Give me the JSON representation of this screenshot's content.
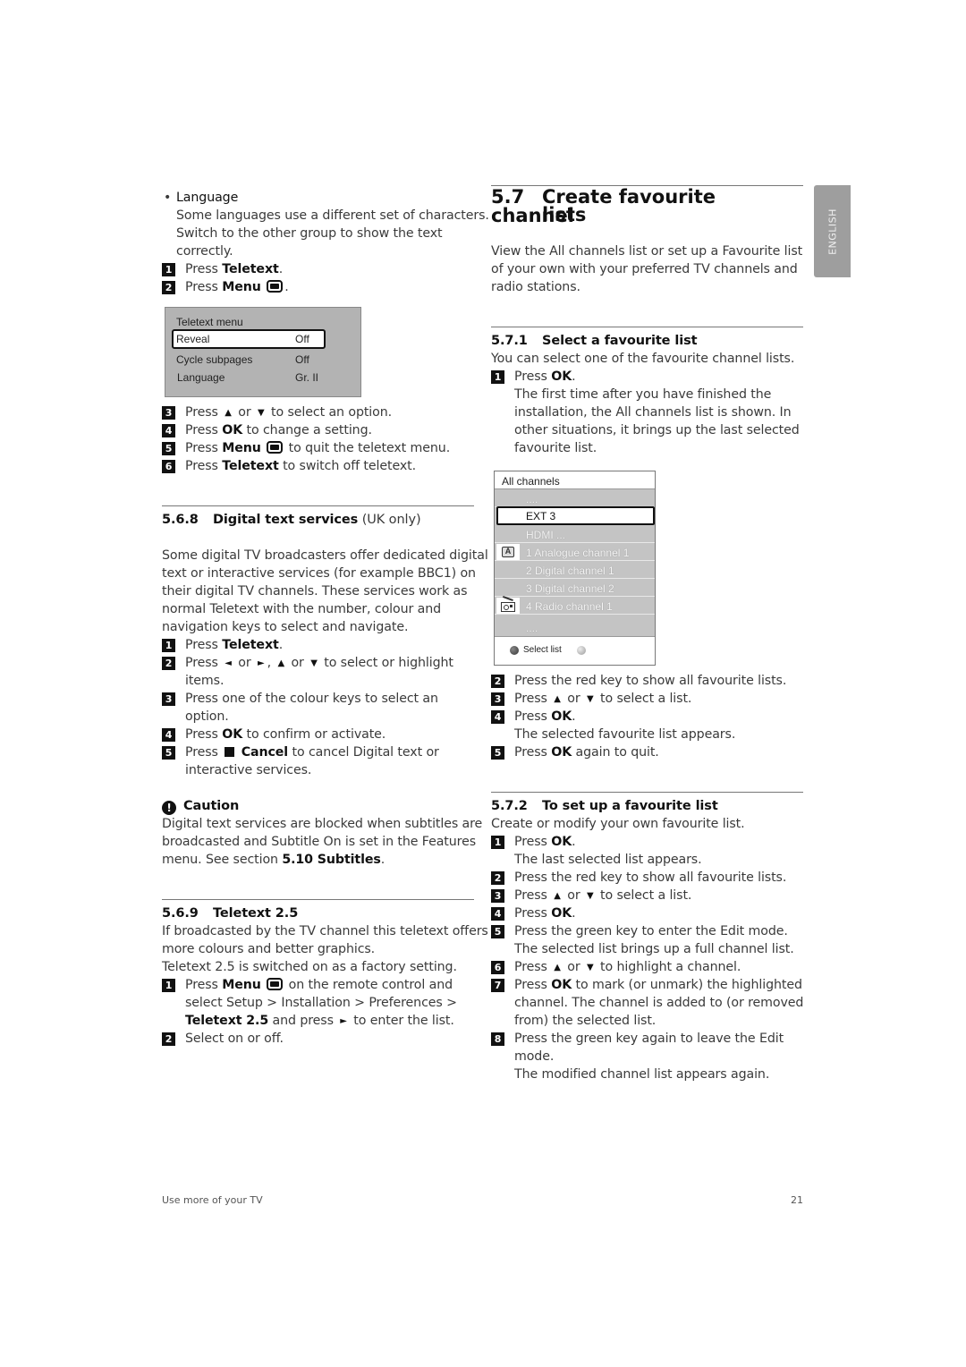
{
  "left": {
    "language_bullet": "Language",
    "language_desc": [
      "Some languages use a different set of characters.",
      "Switch to the other group to show the text",
      "correctly."
    ],
    "steps_a": [
      {
        "n": "1",
        "pre": "Press ",
        "key": "Teletext",
        "post": "."
      },
      {
        "n": "2",
        "pre": "Press ",
        "key": "Menu",
        "post": "."
      }
    ],
    "teletext_menu": {
      "title": "Teletext menu",
      "rows": [
        {
          "label": "Reveal",
          "value": "Off",
          "selected": true
        },
        {
          "label": "Cycle subpages",
          "value": "Off"
        },
        {
          "label": "Language",
          "value": "Gr. II"
        }
      ]
    },
    "steps_b": [
      {
        "n": "3",
        "pre": "Press",
        "mid": "or",
        "post": "to select an option."
      },
      {
        "n": "4",
        "pre": "Press ",
        "key": "OK",
        "post": " to change a setting."
      },
      {
        "n": "5",
        "pre": "Press ",
        "key": "Menu",
        "post": " to quit the teletext menu."
      },
      {
        "n": "6",
        "pre": "Press ",
        "key": "Teletext",
        "post": " to switch off teletext."
      }
    ],
    "s568": {
      "num": "5.6.8",
      "title": "Digital text services",
      "suffix": " (UK only)",
      "para": [
        "Some digital TV broadcasters offer dedicated digital",
        "text or interactive services (for example BBC1) on",
        "their digital TV channels. These services work as",
        "normal Teletext with the number, colour and",
        "navigation keys to select and navigate."
      ],
      "step1": {
        "n": "1",
        "pre": "Press ",
        "key": "Teletext",
        "post": "."
      },
      "step2": {
        "n": "2",
        "pre": "Press",
        "or1": "or",
        "or2": "or",
        "post": "to select or highlight",
        "cont": "items."
      },
      "step3": {
        "n": "3",
        "text": "Press one of the colour keys to select an",
        "cont": "option."
      },
      "step4": {
        "n": "4",
        "pre": "Press ",
        "key": "OK",
        "post": " to confirm or activate."
      },
      "step5": {
        "n": "5",
        "pre": "Press",
        "key": "Cancel",
        "post": " to cancel Digital text or",
        "cont": "interactive services."
      }
    },
    "caution": {
      "title": "Caution",
      "lines": [
        "Digital text services are blocked when subtitles are",
        "broadcasted and Subtitle On is set in the Features"
      ],
      "last_pre": "menu. See section ",
      "last_key": "5.10 Subtitles",
      "last_post": "."
    },
    "s569": {
      "num": "5.6.9",
      "title": "Teletext 2.5",
      "para": [
        "If broadcasted by the TV channel this teletext offers",
        "more colours and better graphics.",
        "Teletext 2.5 is switched on as a factory setting."
      ],
      "step1": {
        "n": "1",
        "pre": "Press ",
        "key": "Menu",
        "post": " on the remote control and",
        "cont1": "select Setup > Installation > Preferences >",
        "cont2_key": "Teletext 2.5",
        "cont2_post": " and press",
        "cont2_end": "to enter the list."
      },
      "step2": {
        "n": "2",
        "text": "Select on or off."
      }
    }
  },
  "right": {
    "s57": {
      "num": "5.7",
      "title_l1": "Create favourite channel",
      "title_l2": "lists"
    },
    "intro": [
      "View the All channels list or set up a Favourite list",
      "of your own with your preferred TV channels and",
      "radio stations."
    ],
    "s571": {
      "num": "5.7.1",
      "title": "Select a favourite list",
      "desc": "You can select one of the favourite channel lists.",
      "step1": {
        "n": "1",
        "pre": "Press ",
        "key": "OK",
        "post": "."
      },
      "step1_desc": [
        "The first time after you have finished the",
        "installation, the All channels list is shown. In",
        "other situations, it brings up the last selected",
        "favourite list."
      ]
    },
    "channel_list": {
      "title": "All channels",
      "rows": [
        {
          "text": "....",
          "icon": ""
        },
        {
          "text": "EXT 3",
          "icon": "",
          "selected": true
        },
        {
          "text": "HDMI ...",
          "icon": ""
        },
        {
          "text": "1 Analogue channel 1",
          "icon": "analogue-icon"
        },
        {
          "text": "2 Digital channel 1",
          "icon": ""
        },
        {
          "text": "3 Digital channel 2",
          "icon": ""
        },
        {
          "text": "4 Radio channel 1",
          "icon": "radio-icon"
        },
        {
          "text": "....",
          "icon": ""
        }
      ],
      "footer_label": "Select list",
      "analogue_glyph": "A"
    },
    "s571_steps": [
      {
        "n": "2",
        "text": "Press the red key to show all favourite lists."
      },
      {
        "n": "3",
        "pre": "Press",
        "mid": "or",
        "post": "to select a list."
      },
      {
        "n": "4",
        "pre": "Press ",
        "key": "OK",
        "post": ".",
        "cont": "The selected favourite list appears."
      },
      {
        "n": "5",
        "pre": "Press ",
        "key": "OK",
        "post": " again to quit."
      }
    ],
    "s572": {
      "num": "5.7.2",
      "title": "To set up a favourite list",
      "desc": "Create or modify your own favourite list.",
      "steps": [
        {
          "n": "1",
          "pre": "Press ",
          "key": "OK",
          "post": ".",
          "cont": "The last selected list appears."
        },
        {
          "n": "2",
          "text": "Press the red key to show all favourite lists."
        },
        {
          "n": "3",
          "pre": "Press",
          "mid": "or",
          "post": "to select a list."
        },
        {
          "n": "4",
          "pre": "Press ",
          "key": "OK",
          "post": "."
        },
        {
          "n": "5",
          "text": "Press the green key to enter the Edit mode.",
          "cont": "The selected list brings up a full channel list."
        },
        {
          "n": "6",
          "pre": "Press",
          "mid": "or",
          "post": "to highlight a channel."
        },
        {
          "n": "7",
          "pre": "Press ",
          "key": "OK",
          "post": " to mark (or unmark) the highlighted",
          "cont1": "channel. The channel is added to (or removed",
          "cont2": "from) the selected list."
        },
        {
          "n": "8",
          "text": "Press the green key again to leave the Edit",
          "cont1": "mode.",
          "cont2": "The modified channel list appears again."
        }
      ]
    }
  },
  "side_tab": "ENGLISH",
  "footer": {
    "left": "Use more of your TV",
    "page": "21"
  },
  "glyphs": {
    "up": "▲",
    "down": "▼",
    "left": "◄",
    "right": "►",
    "bullet": "•",
    "caution": "!"
  }
}
